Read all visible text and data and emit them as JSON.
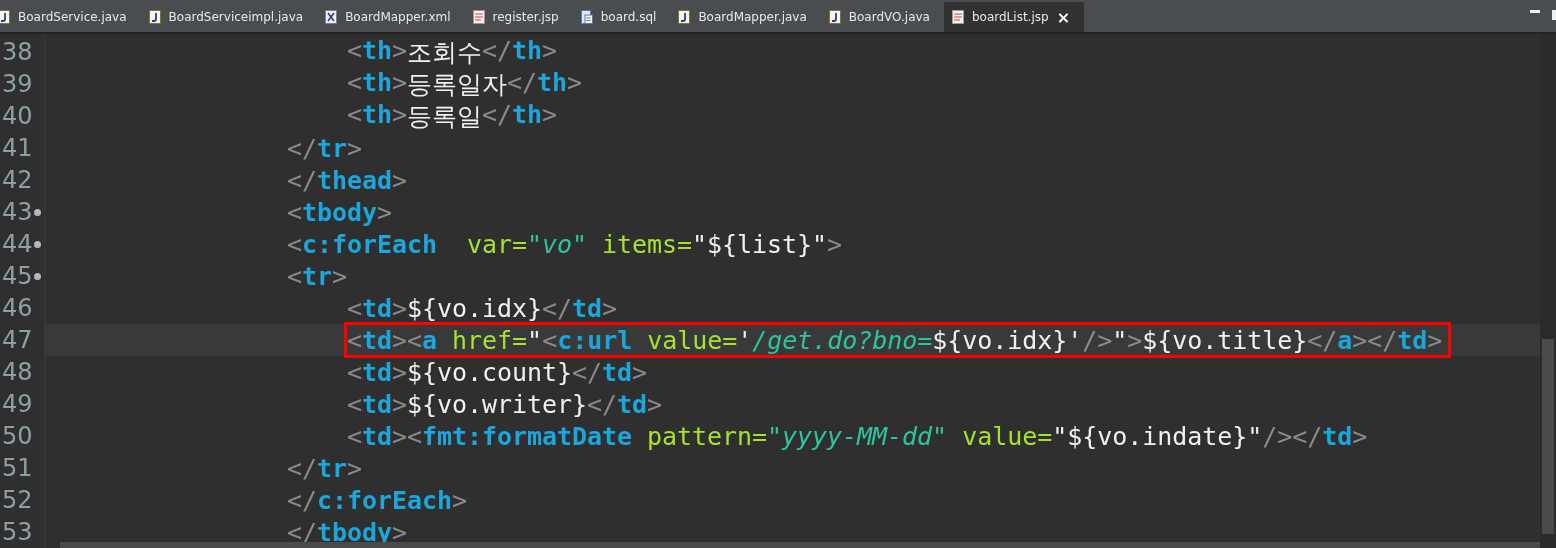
{
  "tabs": [
    {
      "label": "BoardService.java",
      "kind": "java",
      "selected": false
    },
    {
      "label": "BoardServiceimpl.java",
      "kind": "java",
      "selected": false
    },
    {
      "label": "BoardMapper.xml",
      "kind": "xml",
      "selected": false
    },
    {
      "label": "register.jsp",
      "kind": "jsp",
      "selected": false
    },
    {
      "label": "board.sql",
      "kind": "sql",
      "selected": false
    },
    {
      "label": "BoardMapper.java",
      "kind": "java",
      "selected": false
    },
    {
      "label": "BoardVO.java",
      "kind": "java",
      "selected": false
    },
    {
      "label": "boardList.jsp",
      "kind": "jsp",
      "selected": true,
      "close": "×"
    }
  ],
  "lines": [
    {
      "number": "38",
      "fold": false,
      "boxed": false,
      "tokens": [
        {
          "kind": "punct",
          "text": "                    <"
        },
        {
          "kind": "tag",
          "text": "th"
        },
        {
          "kind": "punct",
          "text": ">"
        },
        {
          "kind": "text",
          "text": "조회수"
        },
        {
          "kind": "punct",
          "text": "</"
        },
        {
          "kind": "tag",
          "text": "th"
        },
        {
          "kind": "punct",
          "text": ">"
        }
      ]
    },
    {
      "number": "39",
      "fold": false,
      "boxed": false,
      "tokens": [
        {
          "kind": "punct",
          "text": "                    <"
        },
        {
          "kind": "tag",
          "text": "th"
        },
        {
          "kind": "punct",
          "text": ">"
        },
        {
          "kind": "text",
          "text": "등록일자"
        },
        {
          "kind": "punct",
          "text": "</"
        },
        {
          "kind": "tag",
          "text": "th"
        },
        {
          "kind": "punct",
          "text": ">"
        }
      ]
    },
    {
      "number": "40",
      "fold": false,
      "boxed": false,
      "tokens": [
        {
          "kind": "punct",
          "text": "                    <"
        },
        {
          "kind": "tag",
          "text": "th"
        },
        {
          "kind": "punct",
          "text": ">"
        },
        {
          "kind": "text",
          "text": "등록일"
        },
        {
          "kind": "punct",
          "text": "</"
        },
        {
          "kind": "tag",
          "text": "th"
        },
        {
          "kind": "punct",
          "text": ">"
        }
      ]
    },
    {
      "number": "41",
      "fold": false,
      "boxed": false,
      "tokens": [
        {
          "kind": "punct",
          "text": "                </"
        },
        {
          "kind": "tag",
          "text": "tr"
        },
        {
          "kind": "punct",
          "text": ">"
        }
      ]
    },
    {
      "number": "42",
      "fold": false,
      "boxed": false,
      "tokens": [
        {
          "kind": "punct",
          "text": "                </"
        },
        {
          "kind": "tag",
          "text": "thead"
        },
        {
          "kind": "punct",
          "text": ">"
        }
      ]
    },
    {
      "number": "43",
      "fold": true,
      "boxed": false,
      "tokens": [
        {
          "kind": "punct",
          "text": "                <"
        },
        {
          "kind": "tag",
          "text": "tbody"
        },
        {
          "kind": "punct",
          "text": ">"
        }
      ]
    },
    {
      "number": "44",
      "fold": true,
      "boxed": false,
      "tokens": [
        {
          "kind": "punct",
          "text": "                <"
        },
        {
          "kind": "tag",
          "text": "c:forEach"
        },
        {
          "kind": "attr",
          "text": "  var="
        },
        {
          "kind": "string",
          "text": "\"vo\""
        },
        {
          "kind": "attr",
          "text": " items="
        },
        {
          "kind": "text",
          "text": "\"${list}\""
        },
        {
          "kind": "punct",
          "text": ">"
        }
      ]
    },
    {
      "number": "45",
      "fold": true,
      "boxed": false,
      "tokens": [
        {
          "kind": "punct",
          "text": "                <"
        },
        {
          "kind": "tag",
          "text": "tr"
        },
        {
          "kind": "punct",
          "text": ">"
        }
      ]
    },
    {
      "number": "46",
      "fold": false,
      "boxed": false,
      "tokens": [
        {
          "kind": "punct",
          "text": "                    <"
        },
        {
          "kind": "tag",
          "text": "td"
        },
        {
          "kind": "punct",
          "text": ">"
        },
        {
          "kind": "text",
          "text": "${vo.idx}"
        },
        {
          "kind": "punct",
          "text": "</"
        },
        {
          "kind": "tag",
          "text": "td"
        },
        {
          "kind": "punct",
          "text": ">"
        }
      ]
    },
    {
      "number": "47",
      "fold": false,
      "boxed": true,
      "tokens": [
        {
          "kind": "punct",
          "text": "                    <"
        },
        {
          "kind": "tag",
          "text": "td"
        },
        {
          "kind": "punct",
          "text": "><"
        },
        {
          "kind": "tag",
          "text": "a"
        },
        {
          "kind": "attr",
          "text": " href="
        },
        {
          "kind": "text",
          "text": "\""
        },
        {
          "kind": "punct",
          "text": "<"
        },
        {
          "kind": "tag",
          "text": "c:url"
        },
        {
          "kind": "attr",
          "text": " value="
        },
        {
          "kind": "text",
          "text": "'"
        },
        {
          "kind": "string",
          "text": "/get.do?bno="
        },
        {
          "kind": "text",
          "text": "${vo.idx}'"
        },
        {
          "kind": "punct",
          "text": "/>"
        },
        {
          "kind": "text",
          "text": "\""
        },
        {
          "kind": "punct",
          "text": ">"
        },
        {
          "kind": "text",
          "text": "${vo.title}"
        },
        {
          "kind": "punct",
          "text": "</"
        },
        {
          "kind": "tag",
          "text": "a"
        },
        {
          "kind": "punct",
          "text": "></"
        },
        {
          "kind": "tag",
          "text": "td"
        },
        {
          "kind": "punct",
          "text": ">"
        }
      ]
    },
    {
      "number": "48",
      "fold": false,
      "boxed": false,
      "tokens": [
        {
          "kind": "punct",
          "text": "                    <"
        },
        {
          "kind": "tag",
          "text": "td"
        },
        {
          "kind": "punct",
          "text": ">"
        },
        {
          "kind": "text",
          "text": "${vo.count}"
        },
        {
          "kind": "punct",
          "text": "</"
        },
        {
          "kind": "tag",
          "text": "td"
        },
        {
          "kind": "punct",
          "text": ">"
        }
      ]
    },
    {
      "number": "49",
      "fold": false,
      "boxed": false,
      "tokens": [
        {
          "kind": "punct",
          "text": "                    <"
        },
        {
          "kind": "tag",
          "text": "td"
        },
        {
          "kind": "punct",
          "text": ">"
        },
        {
          "kind": "text",
          "text": "${vo.writer}"
        },
        {
          "kind": "punct",
          "text": "</"
        },
        {
          "kind": "tag",
          "text": "td"
        },
        {
          "kind": "punct",
          "text": ">"
        }
      ]
    },
    {
      "number": "50",
      "fold": false,
      "boxed": false,
      "tokens": [
        {
          "kind": "punct",
          "text": "                    <"
        },
        {
          "kind": "tag",
          "text": "td"
        },
        {
          "kind": "punct",
          "text": "><"
        },
        {
          "kind": "tag",
          "text": "fmt:formatDate"
        },
        {
          "kind": "attr",
          "text": " pattern="
        },
        {
          "kind": "string",
          "text": "\"yyyy-MM-dd\""
        },
        {
          "kind": "attr",
          "text": " value="
        },
        {
          "kind": "text",
          "text": "\"${vo.indate}\""
        },
        {
          "kind": "punct",
          "text": "/></"
        },
        {
          "kind": "tag",
          "text": "td"
        },
        {
          "kind": "punct",
          "text": ">"
        }
      ]
    },
    {
      "number": "51",
      "fold": false,
      "boxed": false,
      "tokens": [
        {
          "kind": "punct",
          "text": "                </"
        },
        {
          "kind": "tag",
          "text": "tr"
        },
        {
          "kind": "punct",
          "text": ">"
        }
      ]
    },
    {
      "number": "52",
      "fold": false,
      "boxed": false,
      "tokens": [
        {
          "kind": "punct",
          "text": "                </"
        },
        {
          "kind": "tag",
          "text": "c:forEach"
        },
        {
          "kind": "punct",
          "text": ">"
        }
      ]
    },
    {
      "number": "53",
      "fold": false,
      "boxed": false,
      "tokens": [
        {
          "kind": "punct",
          "text": "                </"
        },
        {
          "kind": "tag",
          "text": "tbody"
        },
        {
          "kind": "punct",
          "text": ">"
        }
      ]
    }
  ]
}
